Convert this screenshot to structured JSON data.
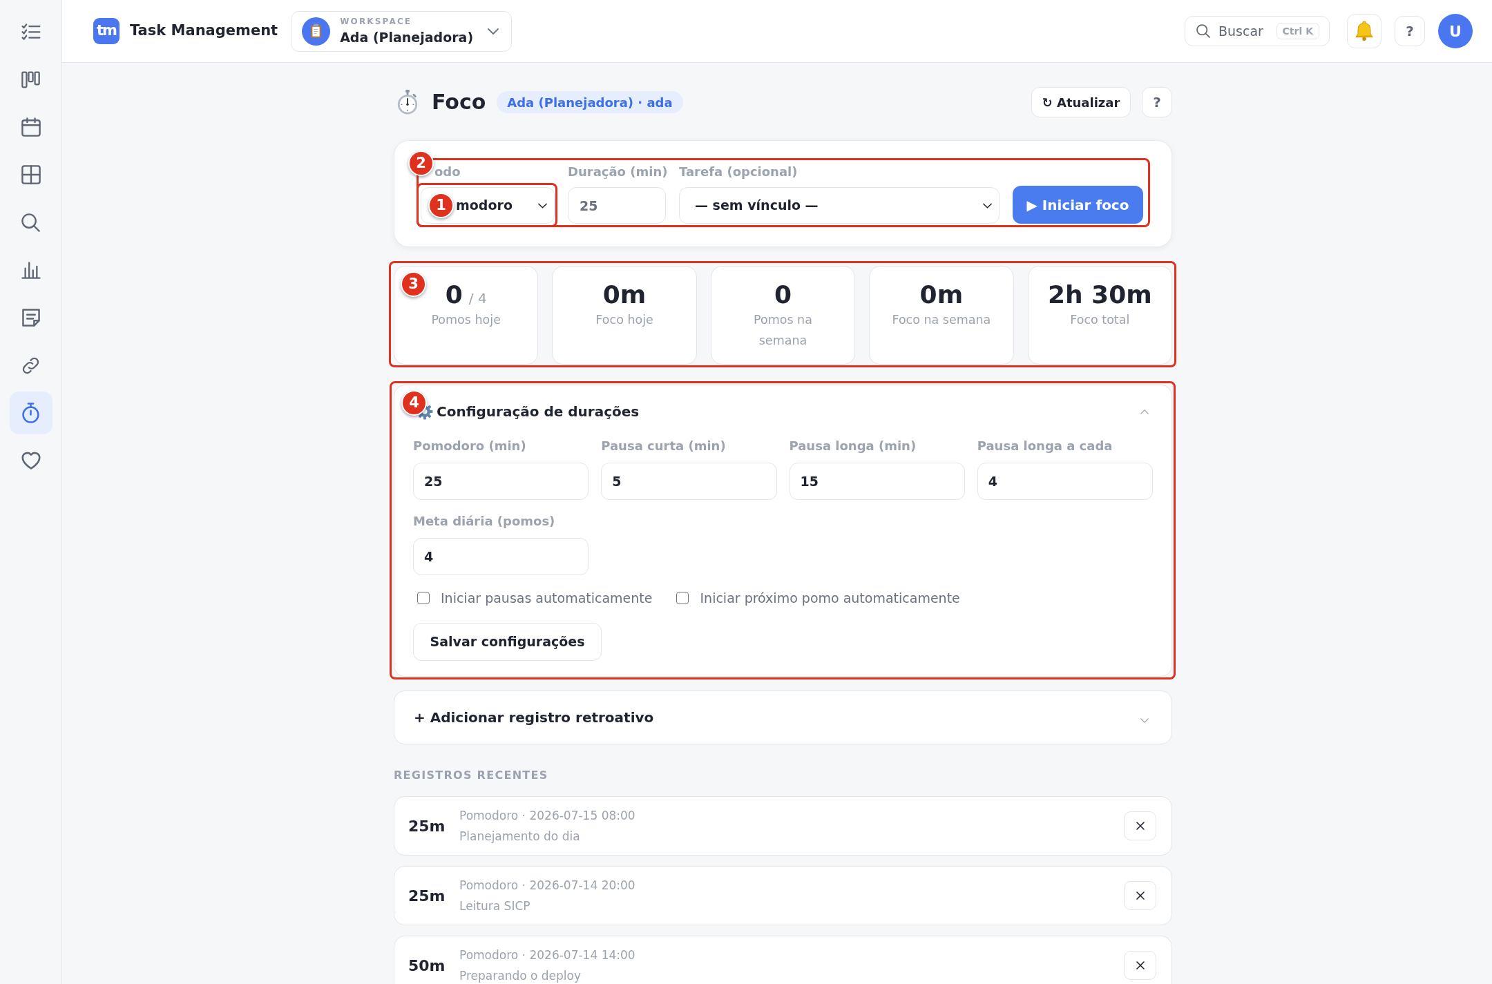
{
  "sidebar": {
    "items": [
      {
        "selected": false
      },
      {
        "selected": false
      },
      {
        "selected": false
      },
      {
        "selected": false
      },
      {
        "selected": false
      },
      {
        "selected": false
      },
      {
        "selected": false
      },
      {
        "selected": false
      },
      {
        "selected": true
      },
      {
        "selected": false
      }
    ]
  },
  "topbar": {
    "logo": "tm",
    "app_name": "Task Management",
    "workspace": {
      "caption": "WORKSPACE",
      "name": "Ada (Planejadora)"
    },
    "search": {
      "label": "Buscar",
      "shortcut": "Ctrl K"
    },
    "help": "?",
    "avatar": "U"
  },
  "header": {
    "title": "Foco",
    "badge": "Ada (Planejadora) · ada",
    "refresh_button": "↻ Atualizar",
    "help_button": "?"
  },
  "timer_form": {
    "annotation": "2",
    "fields": [
      {
        "kind": "select",
        "label": "odo",
        "value": "modoro",
        "annotation": "1"
      },
      {
        "kind": "input",
        "label": "Duração (min)",
        "placeholder": "25"
      },
      {
        "kind": "select",
        "label": "Tarefa (opcional)",
        "value": "— sem vínculo —"
      }
    ],
    "start_button": "▶ Iniciar foco"
  },
  "stats": {
    "annotation": "3",
    "items": [
      {
        "value": "0",
        "goal": "/ 4",
        "label": "Pomos hoje"
      },
      {
        "value": "0m",
        "label": "Foco hoje"
      },
      {
        "value": "0",
        "label": "Pomos na semana"
      },
      {
        "value": "0m",
        "label": "Foco na semana"
      },
      {
        "value": "2h 30m",
        "label": "Foco total"
      }
    ]
  },
  "settings": {
    "annotation": "4",
    "title": "Configuração de durações",
    "expanded": true,
    "fields": [
      {
        "label": "Pomodoro (min)",
        "value": "25"
      },
      {
        "label": "Pausa curta (min)",
        "value": "5"
      },
      {
        "label": "Pausa longa (min)",
        "value": "15"
      },
      {
        "label": "Pausa longa a cada",
        "value": "4"
      },
      {
        "label": "Meta diária (pomos)",
        "value": "4"
      }
    ],
    "options": [
      {
        "label": "Iniciar pausas automaticamente",
        "checked": false
      },
      {
        "label": "Iniciar próximo pomo automaticamente",
        "checked": false
      }
    ],
    "save_button": "Salvar configurações"
  },
  "add_record": {
    "title": "+ Adicionar registro retroativo",
    "expanded": false
  },
  "recent": {
    "heading": "REGISTROS RECENTES",
    "records": [
      {
        "duration": "25m",
        "meta": "Pomodoro · 2026-07-15 08:00",
        "note": "Planejamento do dia"
      },
      {
        "duration": "25m",
        "meta": "Pomodoro · 2026-07-14 20:00",
        "note": "Leitura SICP"
      },
      {
        "duration": "50m",
        "meta": "Pomodoro · 2026-07-14 14:00",
        "note": "Preparando o deploy"
      }
    ]
  }
}
